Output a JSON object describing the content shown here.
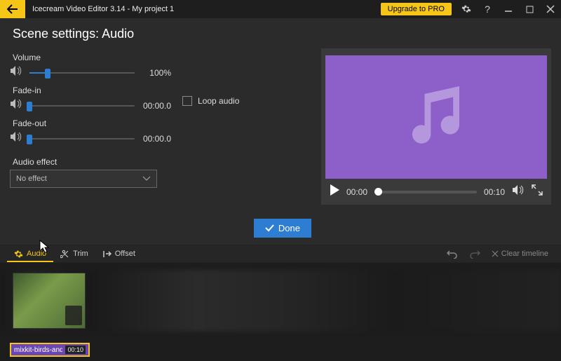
{
  "titlebar": {
    "app": "Icecream Video Editor 3.14",
    "sep": "  -  ",
    "project": "My project 1",
    "upgrade": "Upgrade to PRO"
  },
  "heading": "Scene settings: Audio",
  "controls": {
    "volume_label": "Volume",
    "volume_value": "100%",
    "fadein_label": "Fade-in",
    "fadein_value": "00:00.0",
    "fadeout_label": "Fade-out",
    "fadeout_value": "00:00.0",
    "loop_label": "Loop audio",
    "effect_label": "Audio effect",
    "effect_value": "No effect"
  },
  "done_label": "Done",
  "preview": {
    "time_cur": "00:00",
    "time_total": "00:10"
  },
  "tabs": {
    "audio": "Audio",
    "trim": "Trim",
    "offset": "Offset",
    "clear": "Clear timeline"
  },
  "clip": {
    "name": "mixkit-birds-and...",
    "dur": "00:10"
  }
}
